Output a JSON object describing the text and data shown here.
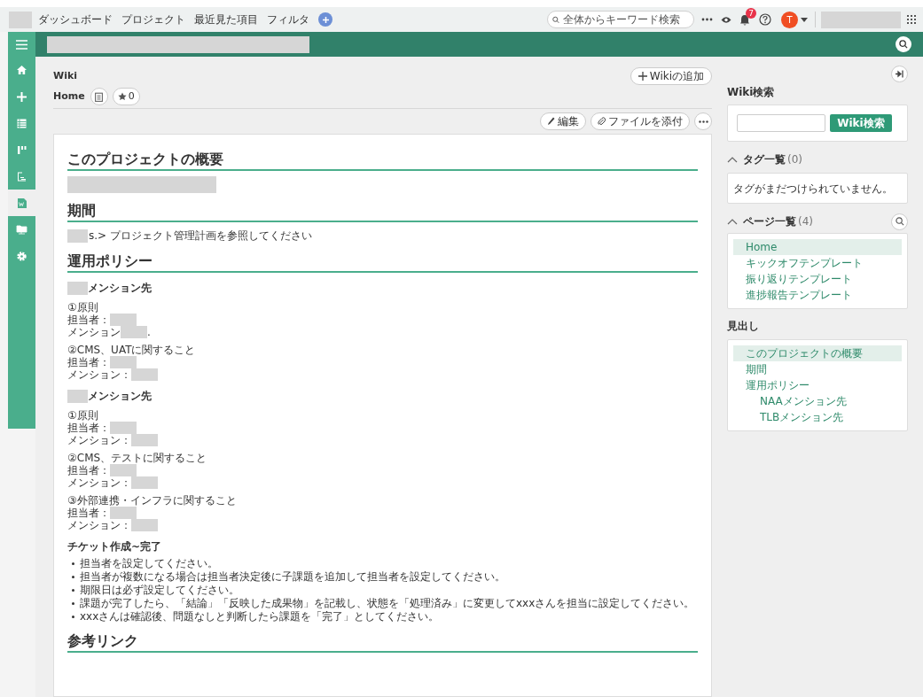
{
  "topbar": {
    "nav": [
      "ダッシュボード",
      "プロジェクト",
      "最近見た項目",
      "フィルタ"
    ],
    "search": {
      "placeholder": "全体からキーワード検索"
    },
    "notifications": "7",
    "avatar": "T"
  },
  "sidebar": {
    "items": [
      {
        "kind": "home",
        "selected": false
      },
      {
        "kind": "add",
        "selected": false
      },
      {
        "kind": "list",
        "selected": false
      },
      {
        "kind": "board",
        "selected": false
      },
      {
        "kind": "document",
        "selected": false
      },
      {
        "kind": "wiki",
        "selected": true
      },
      {
        "kind": "folder",
        "selected": false
      },
      {
        "kind": "settings",
        "selected": false
      }
    ]
  },
  "wiki": {
    "section": "Wiki",
    "add_button": "Wikiの追加",
    "title": "Home",
    "stars": "0",
    "actions": [
      "編集",
      "ファイルを添付"
    ]
  },
  "content": [
    {
      "kind": "h2",
      "text": "このプロジェクトの概要"
    },
    {
      "kind": "redaction"
    },
    {
      "kind": "h2",
      "text": "期間"
    },
    {
      "kind": "p",
      "text": "s.> プロジェクト管理計画を参照してください",
      "redacted": true
    },
    {
      "kind": "h2",
      "text": "運用ポリシー"
    },
    {
      "kind": "h4",
      "text": "メンション先",
      "redacted": true
    },
    {
      "kind": "group",
      "lines": [
        {
          "text": "①原則"
        },
        {
          "text": "担当者：",
          "redacted": true
        },
        {
          "text": "メンション",
          "redacted": true,
          "tail": "."
        }
      ]
    },
    {
      "kind": "group",
      "lines": [
        {
          "text": "②CMS、UATに関すること"
        },
        {
          "text": "担当者：",
          "redacted": true
        },
        {
          "text": "メンション：",
          "redacted": true
        }
      ]
    },
    {
      "kind": "h4",
      "text": "メンション先",
      "redacted": true
    },
    {
      "kind": "group",
      "lines": [
        {
          "text": "①原則"
        },
        {
          "text": "担当者：",
          "redacted": true
        },
        {
          "text": "メンション：",
          "redacted": true
        }
      ]
    },
    {
      "kind": "group",
      "lines": [
        {
          "text": "②CMS、テストに関すること"
        },
        {
          "text": "担当者：",
          "redacted": true
        },
        {
          "text": "メンション：",
          "redacted": true
        }
      ]
    },
    {
      "kind": "group",
      "lines": [
        {
          "text": "③外部連携・インフラに関すること"
        },
        {
          "text": "担当者：",
          "redacted": true
        },
        {
          "text": "メンション：",
          "redacted": true
        }
      ]
    },
    {
      "kind": "h4",
      "text": "チケット作成~完了"
    },
    {
      "kind": "ul",
      "items": [
        "担当者を設定してください。",
        "担当者が複数になる場合は担当者決定後に子課題を追加して担当者を設定してください。",
        "期限日は必ず設定してください。",
        "課題が完了したら、「結論」「反映した成果物」を記載し、状態を「処理済み」に変更してxxxさんを担当に設定してください。",
        "xxxさんは確認後、問題なしと判断したら課題を「完了」としてください。"
      ]
    },
    {
      "kind": "h2",
      "text": "参考リンク"
    }
  ],
  "side": {
    "search": {
      "title": "Wiki検索",
      "button": "Wiki検索"
    },
    "tags": {
      "title": "タグ一覧",
      "count": "(0)",
      "expanded": true,
      "empty": "タグがまだつけられていません。"
    },
    "pages": {
      "title": "ページ一覧",
      "count": "(4)",
      "expanded": true,
      "items": [
        {
          "label": "Home",
          "selected": true
        },
        {
          "label": "キックオフテンプレート",
          "selected": false
        },
        {
          "label": "振り返りテンプレート",
          "selected": false
        },
        {
          "label": "進捗報告テンプレート",
          "selected": false
        }
      ]
    },
    "headings": {
      "title": "見出し",
      "items": [
        {
          "label": "このプロジェクトの概要",
          "selected": true
        },
        {
          "label": "期間",
          "selected": false
        },
        {
          "label": "運用ポリシー",
          "selected": false,
          "children": [
            {
              "label": "NAAメンション先",
              "selected": false
            },
            {
              "label": "TLBメンション先",
              "selected": false
            }
          ]
        }
      ]
    }
  }
}
